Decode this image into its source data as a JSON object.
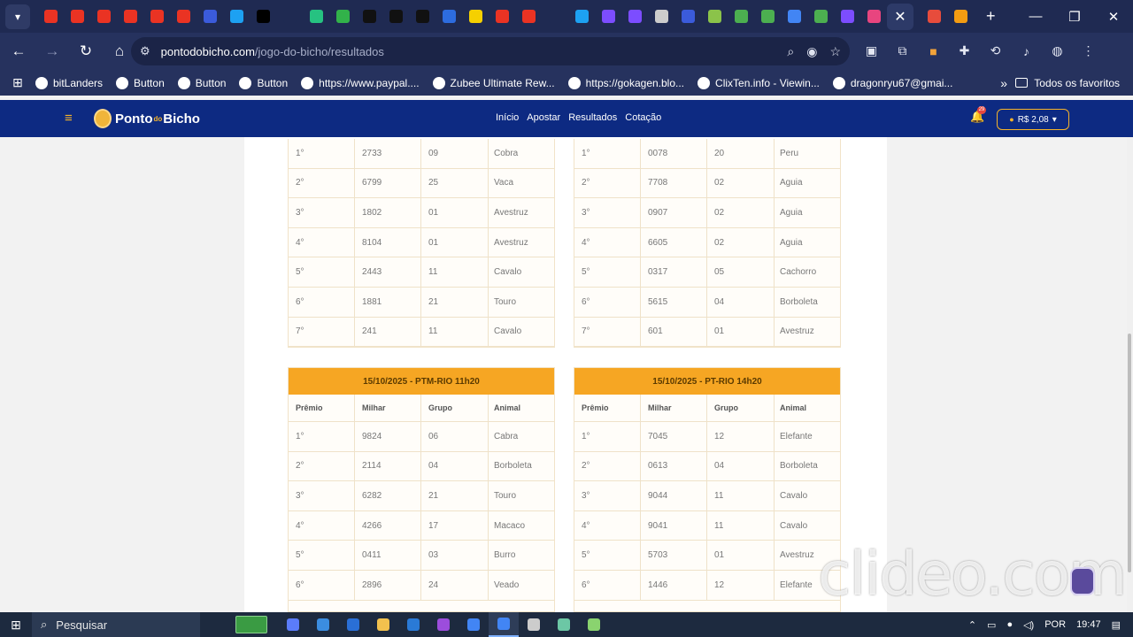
{
  "browser": {
    "tab_menu_icon": "chevron-down-icon",
    "tab_favicons": [
      "#ea3323",
      "#ea3323",
      "#ea3323",
      "#ea3323",
      "#ea3323",
      "#ea3323",
      "#3b5bdb",
      "#1da1f2",
      "#000000",
      "#1f2a52",
      "#26c281",
      "#32b24a",
      "#111111",
      "#111111",
      "#111111",
      "#2d6cdf",
      "#f5d000",
      "#ea3323",
      "#ea3323",
      "#1f2a52",
      "#1da1f2",
      "#7c4dff",
      "#7c4dff",
      "#cccccc",
      "#3b5bdb",
      "#8bc34a",
      "#4caf50",
      "#4caf50",
      "#4285f4",
      "#4caf50",
      "#7c4dff",
      "#e8457f"
    ],
    "active_tab_close": "✕",
    "extra_tab_favicons": [
      "#e74c3c",
      "#f39c12"
    ],
    "new_tab": "+",
    "window_controls": [
      "—",
      "❐",
      "✕"
    ],
    "url_host": "pontodobicho.com",
    "url_path": "/jogo-do-bicho/resultados",
    "bookmarks": [
      "bitLanders",
      "Button",
      "Button",
      "Button",
      "https://www.paypal....",
      "Zubee Ultimate Rew...",
      "https://gokagen.blo...",
      "ClixTen.info - Viewin...",
      "dragonryu67@gmai..."
    ],
    "bookmarks_more": "»",
    "bookmarks_folder": "Todos os favoritos"
  },
  "site": {
    "logo_main": "Ponto",
    "logo_small": "do",
    "logo_end": "Bicho",
    "nav": [
      "Início",
      "Apostar",
      "Resultados",
      "Cotação"
    ],
    "notification_count": "29",
    "balance": "R$ 2,08"
  },
  "results": {
    "columns": [
      "Prêmio",
      "Milhar",
      "Grupo",
      "Animal"
    ],
    "top_left": [
      [
        "1°",
        "2733",
        "09",
        "Cobra"
      ],
      [
        "2°",
        "6799",
        "25",
        "Vaca"
      ],
      [
        "3°",
        "1802",
        "01",
        "Avestruz"
      ],
      [
        "4°",
        "8104",
        "01",
        "Avestruz"
      ],
      [
        "5°",
        "2443",
        "11",
        "Cavalo"
      ],
      [
        "6°",
        "1881",
        "21",
        "Touro"
      ],
      [
        "7°",
        "241",
        "11",
        "Cavalo"
      ]
    ],
    "top_right": [
      [
        "1°",
        "0078",
        "20",
        "Peru"
      ],
      [
        "2°",
        "7708",
        "02",
        "Aguia"
      ],
      [
        "3°",
        "0907",
        "02",
        "Aguia"
      ],
      [
        "4°",
        "6605",
        "02",
        "Aguia"
      ],
      [
        "5°",
        "0317",
        "05",
        "Cachorro"
      ],
      [
        "6°",
        "5615",
        "04",
        "Borboleta"
      ],
      [
        "7°",
        "601",
        "01",
        "Avestruz"
      ]
    ],
    "bottom_left": {
      "title": "15/10/2025 - PTM-RIO 11h20",
      "rows": [
        [
          "1°",
          "9824",
          "06",
          "Cabra"
        ],
        [
          "2°",
          "2114",
          "04",
          "Borboleta"
        ],
        [
          "3°",
          "6282",
          "21",
          "Touro"
        ],
        [
          "4°",
          "4266",
          "17",
          "Macaco"
        ],
        [
          "5°",
          "0411",
          "03",
          "Burro"
        ],
        [
          "6°",
          "2896",
          "24",
          "Veado"
        ]
      ]
    },
    "bottom_right": {
      "title": "15/10/2025 - PT-RIO 14h20",
      "rows": [
        [
          "1°",
          "7045",
          "12",
          "Elefante"
        ],
        [
          "2°",
          "0613",
          "04",
          "Borboleta"
        ],
        [
          "3°",
          "9044",
          "11",
          "Cavalo"
        ],
        [
          "4°",
          "9041",
          "11",
          "Cavalo"
        ],
        [
          "5°",
          "5703",
          "01",
          "Avestruz"
        ],
        [
          "6°",
          "1446",
          "12",
          "Elefante"
        ]
      ]
    }
  },
  "watermark": "clideo.com",
  "taskbar": {
    "search_placeholder": "Pesquisar",
    "app_colors": [
      "#5b7cfa",
      "#3b8de0",
      "#2a6fd6",
      "#f2c14e",
      "#2a7ad6",
      "#9c4ddc",
      "#4285f4",
      "#4285f4",
      "#cccccc",
      "#6cc7a5",
      "#8ad36f"
    ],
    "language": "POR",
    "time": "19:47"
  }
}
